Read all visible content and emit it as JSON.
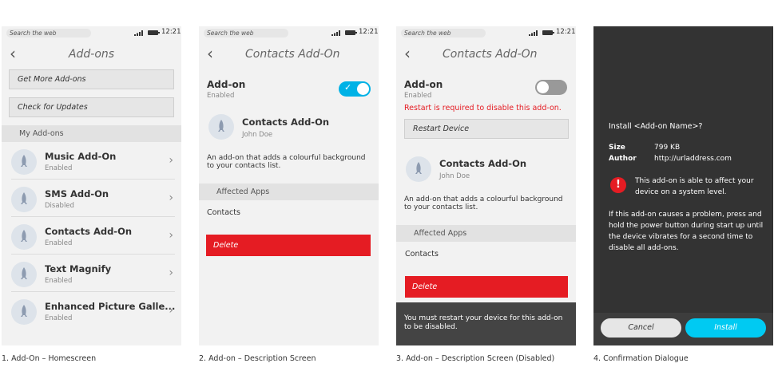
{
  "status": {
    "search_placeholder": "Search the web",
    "time": "12:21"
  },
  "screen1": {
    "title": "Add-ons",
    "get_more": "Get More Add-ons",
    "check_updates": "Check for Updates",
    "section": "My Add-ons",
    "items": [
      {
        "name": "Music Add-On",
        "status": "Enabled"
      },
      {
        "name": "SMS Add-On",
        "status": "Disabled"
      },
      {
        "name": "Contacts Add-On",
        "status": "Enabled"
      },
      {
        "name": "Text Magnify",
        "status": "Enabled"
      },
      {
        "name": "Enhanced Picture Galle...",
        "status": "Enabled"
      }
    ],
    "caption": "1. Add-On – Homescreen"
  },
  "screen2": {
    "title": "Contacts Add-On",
    "addon_label": "Add-on",
    "addon_state": "Enabled",
    "addon_name": "Contacts Add-On",
    "author": "John Doe",
    "description": "An add-on that adds a colourful background to your contacts list.",
    "section": "Affected Apps",
    "app": "Contacts",
    "delete": "Delete",
    "caption": "2.  Add-on – Description Screen"
  },
  "screen3": {
    "title": "Contacts Add-On",
    "addon_label": "Add-on",
    "addon_state": "Enabled",
    "warning": "Restart is required to disable this add-on.",
    "restart": "Restart Device",
    "addon_name": "Contacts Add-On",
    "author": "John Doe",
    "description": "An add-on that adds a colourful background to your contacts list.",
    "section": "Affected Apps",
    "app": "Contacts",
    "delete": "Delete",
    "toast": "You must restart your device for this add-on to be disabled.",
    "caption": "3.  Add-on – Description Screen (Disabled)"
  },
  "screen4": {
    "title": "Install <Add-on Name>?",
    "size_label": "Size",
    "size_value": "799 KB",
    "author_label": "Author",
    "author_value": "http://urladdress.com",
    "alert": "This add-on is able to affect your device on a system level.",
    "info": "If this add-on causes a problem, press and hold the power button during start up until the device vibrates for a second time to disable all add-ons.",
    "cancel": "Cancel",
    "install": "Install",
    "caption": "4. Confirmation Dialogue"
  },
  "colors": {
    "accent": "#00b2e6",
    "danger": "#e51c23",
    "dialog_bg": "#333333"
  }
}
